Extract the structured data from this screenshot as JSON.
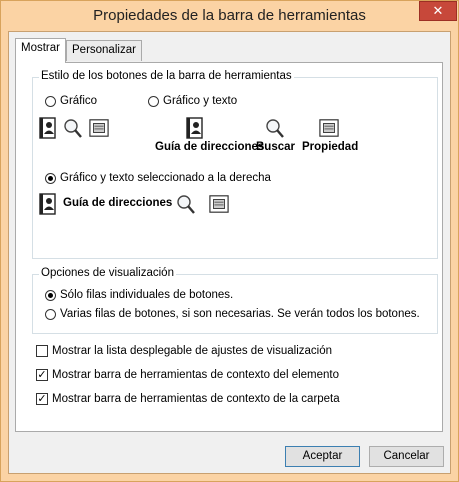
{
  "window": {
    "title": "Propiedades de la barra de herramientas",
    "close": "✕"
  },
  "tabs": [
    {
      "label": "Mostrar"
    },
    {
      "label": "Personalizar"
    }
  ],
  "button_style": {
    "title": "Estilo de los botones de la barra de herramientas",
    "options": [
      {
        "label": "Gráfico",
        "selected": false
      },
      {
        "label": "Gráfico y texto",
        "selected": false
      },
      {
        "label": "Gráfico y texto seleccionado a la derecha",
        "selected": true
      }
    ],
    "preview_text": [
      "Guía de direcciones",
      "Buscar",
      "Propiedad"
    ],
    "preview_right_text": "Guía de direcciones"
  },
  "display_options": {
    "title": "Opciones de visualización",
    "options": [
      {
        "label": "Sólo filas individuales de botones.",
        "selected": true
      },
      {
        "label": "Varias filas de botones, si son necesarias. Se verán todos los botones.",
        "selected": false
      }
    ]
  },
  "checkboxes": [
    {
      "label": "Mostrar la lista desplegable de ajustes de visualización",
      "checked": false,
      "mark": ""
    },
    {
      "label": "Mostrar barra de herramientas de contexto del elemento",
      "checked": true,
      "mark": "✓"
    },
    {
      "label": "Mostrar barra de herramientas de contexto de la carpeta",
      "checked": true,
      "mark": "✓"
    }
  ],
  "buttons": {
    "ok": "Aceptar",
    "cancel": "Cancelar"
  }
}
